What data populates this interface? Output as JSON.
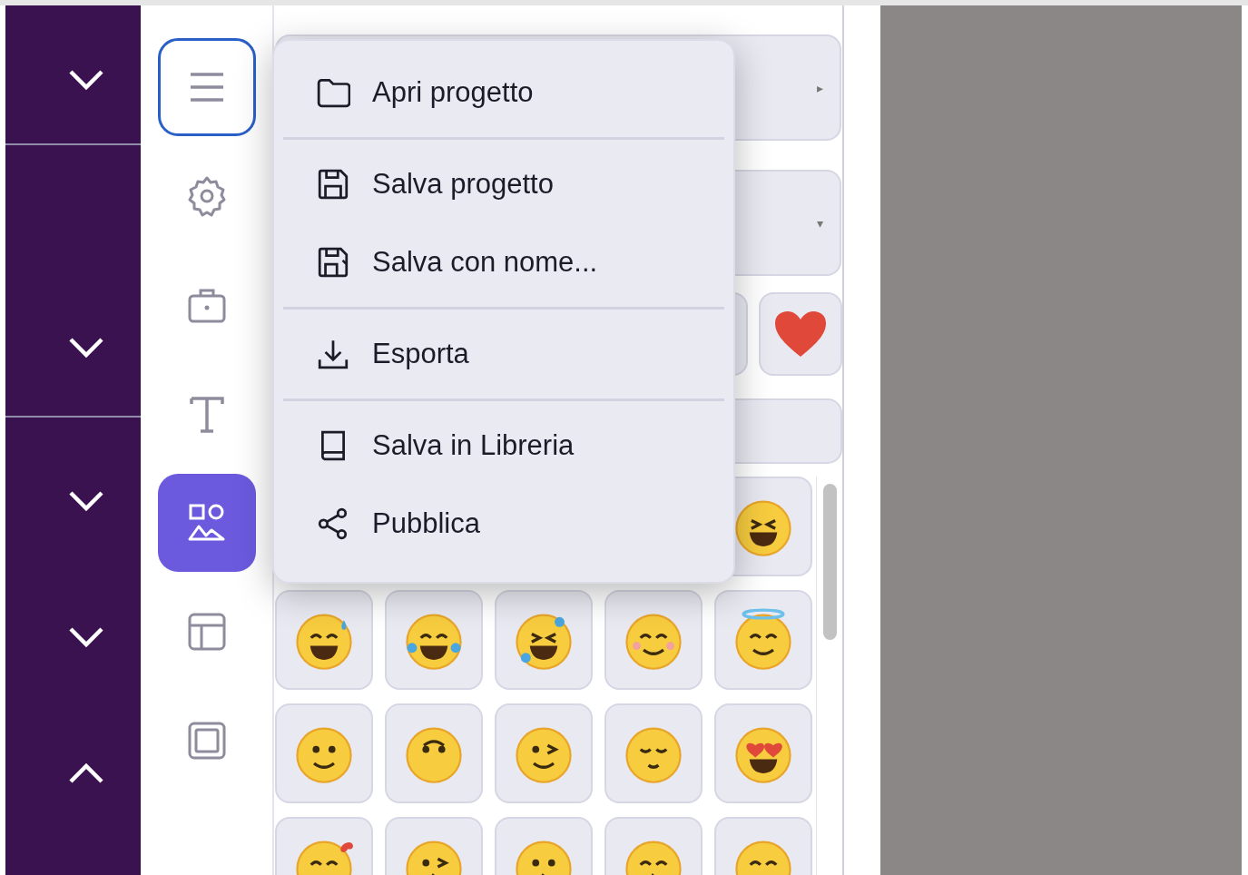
{
  "left_panel": {
    "sections": [
      {
        "expanded": false
      },
      {
        "expanded": false
      },
      {
        "expanded": false
      },
      {
        "expanded": false
      },
      {
        "expanded": true
      }
    ]
  },
  "rail": [
    {
      "selected": false,
      "focused": true
    },
    {
      "selected": false,
      "focused": false
    },
    {
      "selected": false,
      "focused": false
    },
    {
      "selected": false,
      "focused": false
    },
    {
      "selected": true,
      "focused": false
    },
    {
      "selected": false,
      "focused": false
    },
    {
      "selected": false,
      "focused": false
    }
  ],
  "panel": {
    "rows": [
      {
        "arrow": "▸"
      },
      {
        "arrow": "▾"
      }
    ]
  },
  "menu": {
    "groups": [
      [
        {
          "label": "Apri progetto"
        }
      ],
      [
        {
          "label": "Salva progetto"
        },
        {
          "label": "Salva con nome..."
        }
      ],
      [
        {
          "label": "Esporta"
        }
      ],
      [
        {
          "label": "Salva in Libreria"
        },
        {
          "label": "Pubblica"
        }
      ]
    ]
  }
}
